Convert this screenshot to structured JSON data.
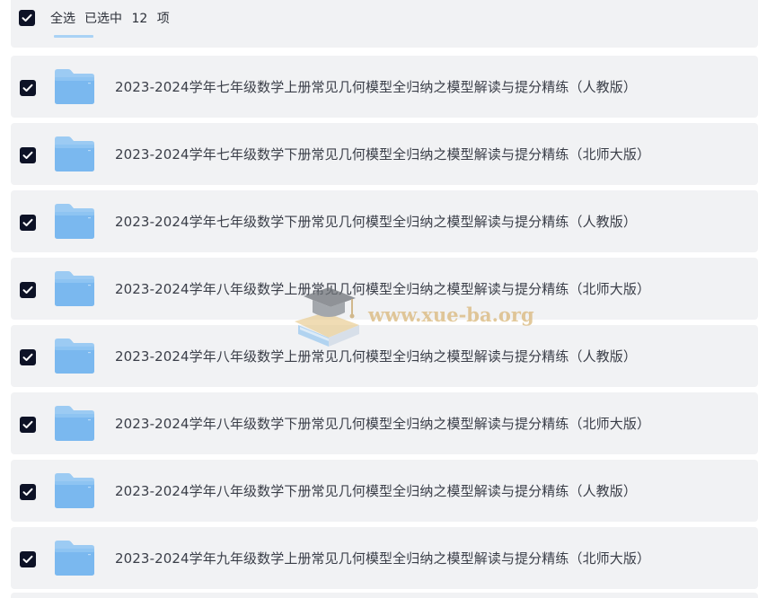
{
  "header": {
    "select_all_label": "全选",
    "selected_prefix": "已选中",
    "selected_count": "12",
    "selected_suffix": "项",
    "checked": true
  },
  "items": [
    {
      "name": "2023-2024学年七年级数学上册常见几何模型全归纳之模型解读与提分精练（人教版）",
      "checked": true,
      "icon": "folder-icon"
    },
    {
      "name": "2023-2024学年七年级数学下册常见几何模型全归纳之模型解读与提分精练（北师大版）",
      "checked": true,
      "icon": "folder-icon"
    },
    {
      "name": "2023-2024学年七年级数学下册常见几何模型全归纳之模型解读与提分精练（人教版）",
      "checked": true,
      "icon": "folder-icon"
    },
    {
      "name": "2023-2024学年八年级数学上册常见几何模型全归纳之模型解读与提分精练（北师大版）",
      "checked": true,
      "icon": "folder-icon"
    },
    {
      "name": "2023-2024学年八年级数学上册常见几何模型全归纳之模型解读与提分精练（人教版）",
      "checked": true,
      "icon": "folder-icon"
    },
    {
      "name": "2023-2024学年八年级数学下册常见几何模型全归纳之模型解读与提分精练（北师大版）",
      "checked": true,
      "icon": "folder-icon"
    },
    {
      "name": "2023-2024学年八年级数学下册常见几何模型全归纳之模型解读与提分精练（人教版）",
      "checked": true,
      "icon": "folder-icon"
    },
    {
      "name": "2023-2024学年九年级数学上册常见几何模型全归纳之模型解读与提分精练（北师大版）",
      "checked": true,
      "icon": "folder-icon"
    }
  ],
  "watermark": {
    "text": "www.xue-ba.org"
  },
  "colors": {
    "row_bg": "#f1f2f4",
    "checkbox": "#0d1226",
    "folder_light": "#a9d2f5",
    "folder_main": "#74b4ec",
    "watermark": "#d9b77a"
  }
}
